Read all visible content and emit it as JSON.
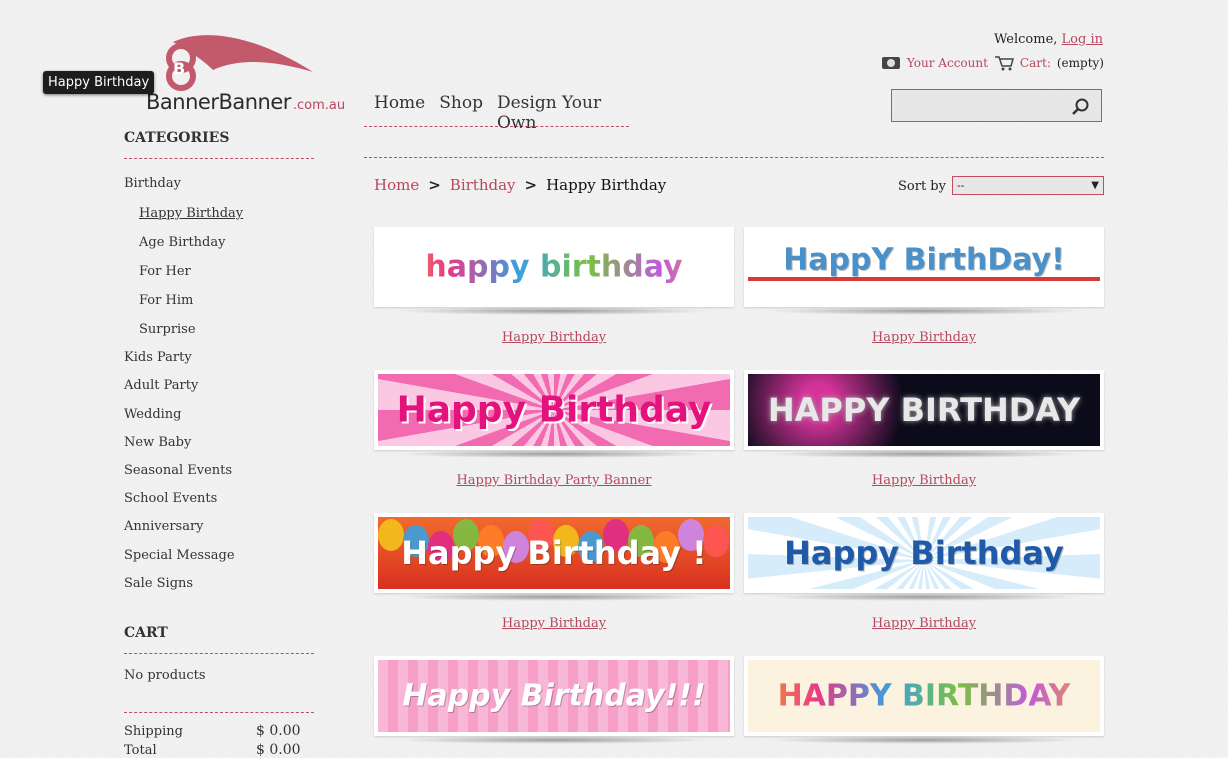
{
  "tooltip": "Happy Birthday",
  "logo": {
    "name": "BannerBanner",
    "domain": ".com.au"
  },
  "header": {
    "welcome": "Welcome,",
    "login": "Log in",
    "your_account": "Your Account",
    "cart_label": "Cart:",
    "cart_status": "(empty)",
    "search_placeholder": ""
  },
  "topnav": [
    "Home",
    "Shop",
    "Design Your Own"
  ],
  "sidebar": {
    "categories_title": "CATEGORIES",
    "categories": [
      {
        "label": "Birthday",
        "level": 0
      },
      {
        "label": "Happy Birthday",
        "level": 1,
        "active": true
      },
      {
        "label": "Age Birthday",
        "level": 1
      },
      {
        "label": "For Her",
        "level": 1
      },
      {
        "label": "For Him",
        "level": 1
      },
      {
        "label": "Surprise",
        "level": 1
      },
      {
        "label": "Kids Party",
        "level": 0
      },
      {
        "label": "Adult Party",
        "level": 0
      },
      {
        "label": "Wedding",
        "level": 0
      },
      {
        "label": "New Baby",
        "level": 0
      },
      {
        "label": "Seasonal Events",
        "level": 0
      },
      {
        "label": "School Events",
        "level": 0
      },
      {
        "label": "Anniversary",
        "level": 0
      },
      {
        "label": "Special Message",
        "level": 0
      },
      {
        "label": "Sale Signs",
        "level": 0
      }
    ],
    "cart_title": "CART",
    "cart_empty": "No products",
    "shipping_label": "Shipping",
    "shipping_value": "$ 0.00",
    "total_label": "Total",
    "total_value": "$ 0.00"
  },
  "breadcrumb": {
    "home": "Home",
    "sep": ">",
    "category": "Birthday",
    "current": "Happy Birthday"
  },
  "sort": {
    "label": "Sort by",
    "selected": "--"
  },
  "products": [
    {
      "title": "Happy Birthday",
      "banner_text": "happy birthday"
    },
    {
      "title": "Happy Birthday",
      "banner_text": "HappY BirthDay!"
    },
    {
      "title": "Happy Birthday Party Banner",
      "banner_text": "Happy Birthday"
    },
    {
      "title": "Happy Birthday",
      "banner_text": "HAPPY BIRTHDAY"
    },
    {
      "title": "Happy Birthday",
      "banner_text": "Happy Birthday !"
    },
    {
      "title": "Happy Birthday",
      "banner_text": "Happy Birthday"
    },
    {
      "title": "",
      "banner_text": "Happy Birthday!!!"
    },
    {
      "title": "",
      "banner_text": "HAPPY BIRTHDAY"
    }
  ],
  "colors": {
    "accent": "#b5485d",
    "rule": "#c04d62"
  }
}
